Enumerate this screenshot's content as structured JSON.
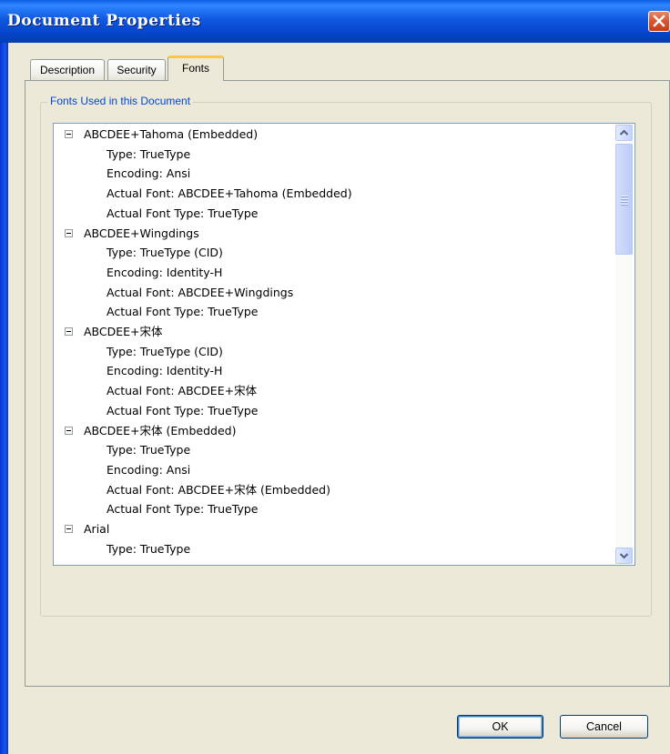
{
  "window": {
    "title": "Document Properties"
  },
  "tabs": [
    {
      "label": "Description"
    },
    {
      "label": "Security"
    },
    {
      "label": "Fonts",
      "active": true
    }
  ],
  "group_label": "Fonts Used in this Document",
  "fonts": [
    {
      "name": "ABCDEE+Tahoma (Embedded)",
      "props": [
        "Type: TrueType",
        "Encoding: Ansi",
        "Actual Font: ABCDEE+Tahoma (Embedded)",
        "Actual Font Type: TrueType"
      ]
    },
    {
      "name": "ABCDEE+Wingdings",
      "props": [
        "Type: TrueType (CID)",
        "Encoding: Identity-H",
        "Actual Font: ABCDEE+Wingdings",
        "Actual Font Type: TrueType"
      ]
    },
    {
      "name": "ABCDEE+宋体",
      "props": [
        "Type: TrueType (CID)",
        "Encoding: Identity-H",
        "Actual Font: ABCDEE+宋体",
        "Actual Font Type: TrueType"
      ]
    },
    {
      "name": "ABCDEE+宋体 (Embedded)",
      "props": [
        "Type: TrueType",
        "Encoding: Ansi",
        "Actual Font: ABCDEE+宋体 (Embedded)",
        "Actual Font Type: TrueType"
      ]
    },
    {
      "name": "Arial",
      "props": [
        "Type: TrueType"
      ]
    }
  ],
  "buttons": {
    "ok": "OK",
    "cancel": "Cancel"
  },
  "colors": {
    "title_bar": "#0a5fe0",
    "group_label": "#0046d5",
    "active_tab_accent": "#ffc83c",
    "close_button": "#d9542c"
  },
  "icons": {
    "close": "close-icon",
    "expander": "collapse-minus-icon",
    "scroll_up": "chevron-up-icon",
    "scroll_down": "chevron-down-icon"
  }
}
